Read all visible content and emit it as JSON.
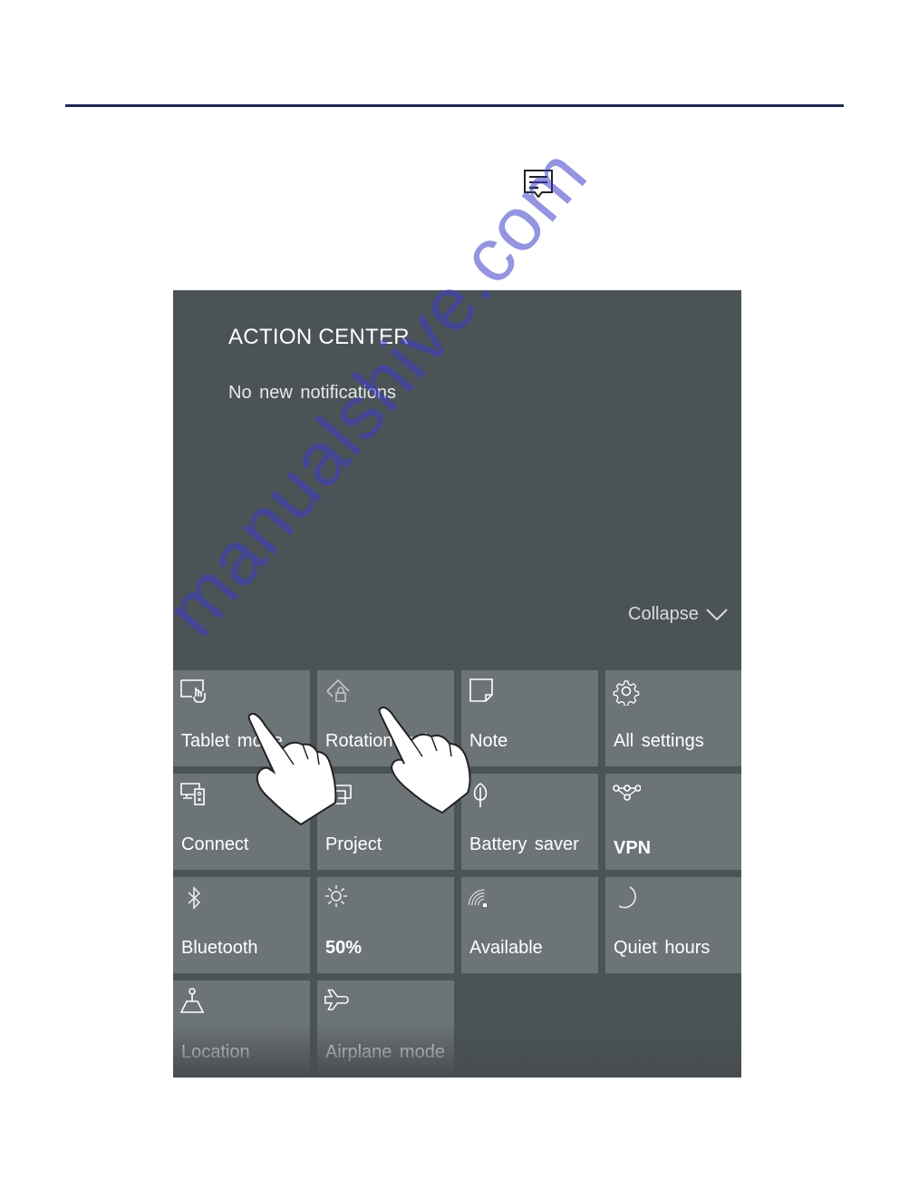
{
  "header": {
    "rule_color": "#1b2a52"
  },
  "action_center_icon": "action-center-message-icon",
  "panel": {
    "title": "ACTION CENTER",
    "status": "No new notifications",
    "collapse_label": "Collapse",
    "background": "#4b5356",
    "tile_color": "#6d7477"
  },
  "tiles": [
    {
      "label": "Tablet mode",
      "icon": "tablet-mode-icon"
    },
    {
      "label": "Rotation lock",
      "icon": "rotation-lock-icon"
    },
    {
      "label": "Note",
      "icon": "note-icon"
    },
    {
      "label": "All settings",
      "icon": "gear-icon"
    },
    {
      "label": "Connect",
      "icon": "connect-icon"
    },
    {
      "label": "Project",
      "icon": "project-icon"
    },
    {
      "label": "Battery saver",
      "icon": "battery-saver-icon"
    },
    {
      "label": "VPN",
      "icon": "vpn-icon"
    },
    {
      "label": "Bluetooth",
      "icon": "bluetooth-icon"
    },
    {
      "label": "50%",
      "icon": "brightness-icon"
    },
    {
      "label": "Available",
      "icon": "wifi-icon"
    },
    {
      "label": "Quiet hours",
      "icon": "moon-icon"
    },
    {
      "label": "Location",
      "icon": "location-icon"
    },
    {
      "label": "Airplane mode",
      "icon": "airplane-icon"
    }
  ],
  "watermark": "manualshive.com"
}
